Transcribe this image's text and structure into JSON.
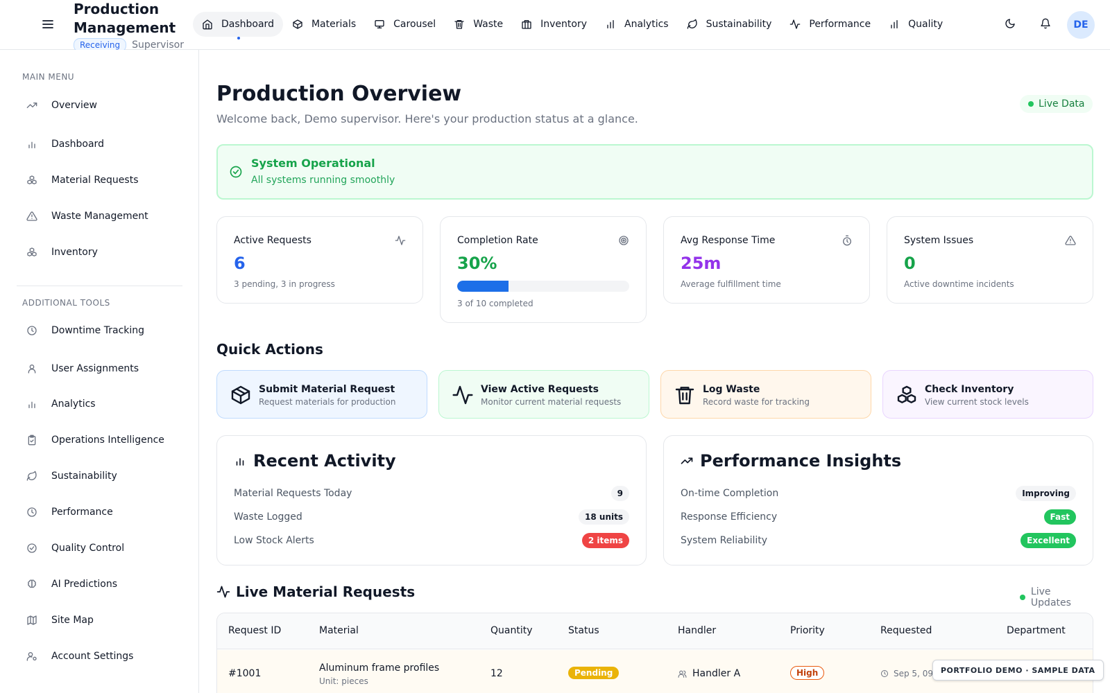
{
  "brand": {
    "title": "Production Management",
    "role_badge": "Receiving",
    "role": "Supervisor"
  },
  "topnav": [
    {
      "label": "Dashboard",
      "icon": "home-icon",
      "active": true
    },
    {
      "label": "Materials",
      "icon": "package-icon"
    },
    {
      "label": "Carousel",
      "icon": "monitor-icon"
    },
    {
      "label": "Waste",
      "icon": "trash-icon"
    },
    {
      "label": "Inventory",
      "icon": "warehouse-icon"
    },
    {
      "label": "Analytics",
      "icon": "bar-chart-icon"
    },
    {
      "label": "Sustainability",
      "icon": "leaf-icon"
    },
    {
      "label": "Performance",
      "icon": "activity-icon"
    },
    {
      "label": "Quality",
      "icon": "bar-chart-icon"
    }
  ],
  "user": {
    "initials": "DE"
  },
  "sidebar": {
    "main_heading": "MAIN MENU",
    "main_items": [
      {
        "label": "Overview",
        "icon": "trending-up-icon"
      },
      {
        "label": "Dashboard",
        "icon": "bar-chart-icon"
      },
      {
        "label": "Material Requests",
        "icon": "boxes-icon"
      },
      {
        "label": "Waste Management",
        "icon": "alert-triangle-icon"
      },
      {
        "label": "Inventory",
        "icon": "boxes-icon"
      }
    ],
    "tools_heading": "ADDITIONAL TOOLS",
    "tool_items": [
      {
        "label": "Downtime Tracking",
        "icon": "clock-icon"
      },
      {
        "label": "User Assignments",
        "icon": "user-icon"
      },
      {
        "label": "Analytics",
        "icon": "bar-chart-icon"
      },
      {
        "label": "Operations Intelligence",
        "icon": "clipboard-icon"
      },
      {
        "label": "Sustainability",
        "icon": "leaf-icon"
      },
      {
        "label": "Performance",
        "icon": "clock-icon"
      },
      {
        "label": "Quality Control",
        "icon": "check-circle-icon"
      },
      {
        "label": "AI Predictions",
        "icon": "brain-icon"
      },
      {
        "label": "Site Map",
        "icon": "map-icon"
      },
      {
        "label": "Account Settings",
        "icon": "user-cog-icon"
      }
    ]
  },
  "page": {
    "title": "Production Overview",
    "subtitle": "Welcome back, Demo supervisor. Here's your production status at a glance.",
    "live_label": "Live Data"
  },
  "system": {
    "title": "System Operational",
    "subtitle": "All systems running smoothly"
  },
  "stats": [
    {
      "label": "Active Requests",
      "value": "6",
      "note": "3 pending, 3 in progress",
      "icon": "activity-icon",
      "color": "#2563eb"
    },
    {
      "label": "Completion Rate",
      "value": "30%",
      "note": "3 of 10 completed",
      "icon": "target-icon",
      "color": "#16a34a",
      "progress": 0.3
    },
    {
      "label": "Avg Response Time",
      "value": "25m",
      "note": "Average fulfillment time",
      "icon": "timer-icon",
      "color": "#9333ea"
    },
    {
      "label": "System Issues",
      "value": "0",
      "note": "Active downtime incidents",
      "icon": "alert-triangle-icon",
      "color": "#16a34a"
    }
  ],
  "quick_actions": {
    "title": "Quick Actions",
    "items": [
      {
        "title": "Submit Material Request",
        "subtitle": "Request materials for production",
        "icon": "package-icon"
      },
      {
        "title": "View Active Requests",
        "subtitle": "Monitor current material requests",
        "icon": "activity-icon"
      },
      {
        "title": "Log Waste",
        "subtitle": "Record waste for tracking",
        "icon": "trash-icon"
      },
      {
        "title": "Check Inventory",
        "subtitle": "View current stock levels",
        "icon": "boxes-icon"
      }
    ]
  },
  "recent_activity": {
    "title": "Recent Activity",
    "rows": [
      {
        "label": "Material Requests Today",
        "value": "9"
      },
      {
        "label": "Waste Logged",
        "value": "18 units"
      },
      {
        "label": "Low Stock Alerts",
        "value": "2 items"
      }
    ]
  },
  "performance_insights": {
    "title": "Performance Insights",
    "rows": [
      {
        "label": "On-time Completion",
        "value": "Improving"
      },
      {
        "label": "Response Efficiency",
        "value": "Fast"
      },
      {
        "label": "System Reliability",
        "value": "Excellent"
      }
    ]
  },
  "live_requests": {
    "title": "Live Material Requests",
    "live_label": "Live Updates",
    "columns": [
      "Request ID",
      "Material",
      "Quantity",
      "Status",
      "Handler",
      "Priority",
      "Requested",
      "Department"
    ],
    "rows": [
      {
        "id": "#1001",
        "material": "Aluminum frame profiles",
        "unit": "Unit: pieces",
        "quantity": "12",
        "status": "Pending",
        "handler": "Handler A",
        "priority": "High",
        "requested": "Sep 5, 09"
      }
    ]
  },
  "demo_tag": "PORTFOLIO DEMO · SAMPLE DATA"
}
